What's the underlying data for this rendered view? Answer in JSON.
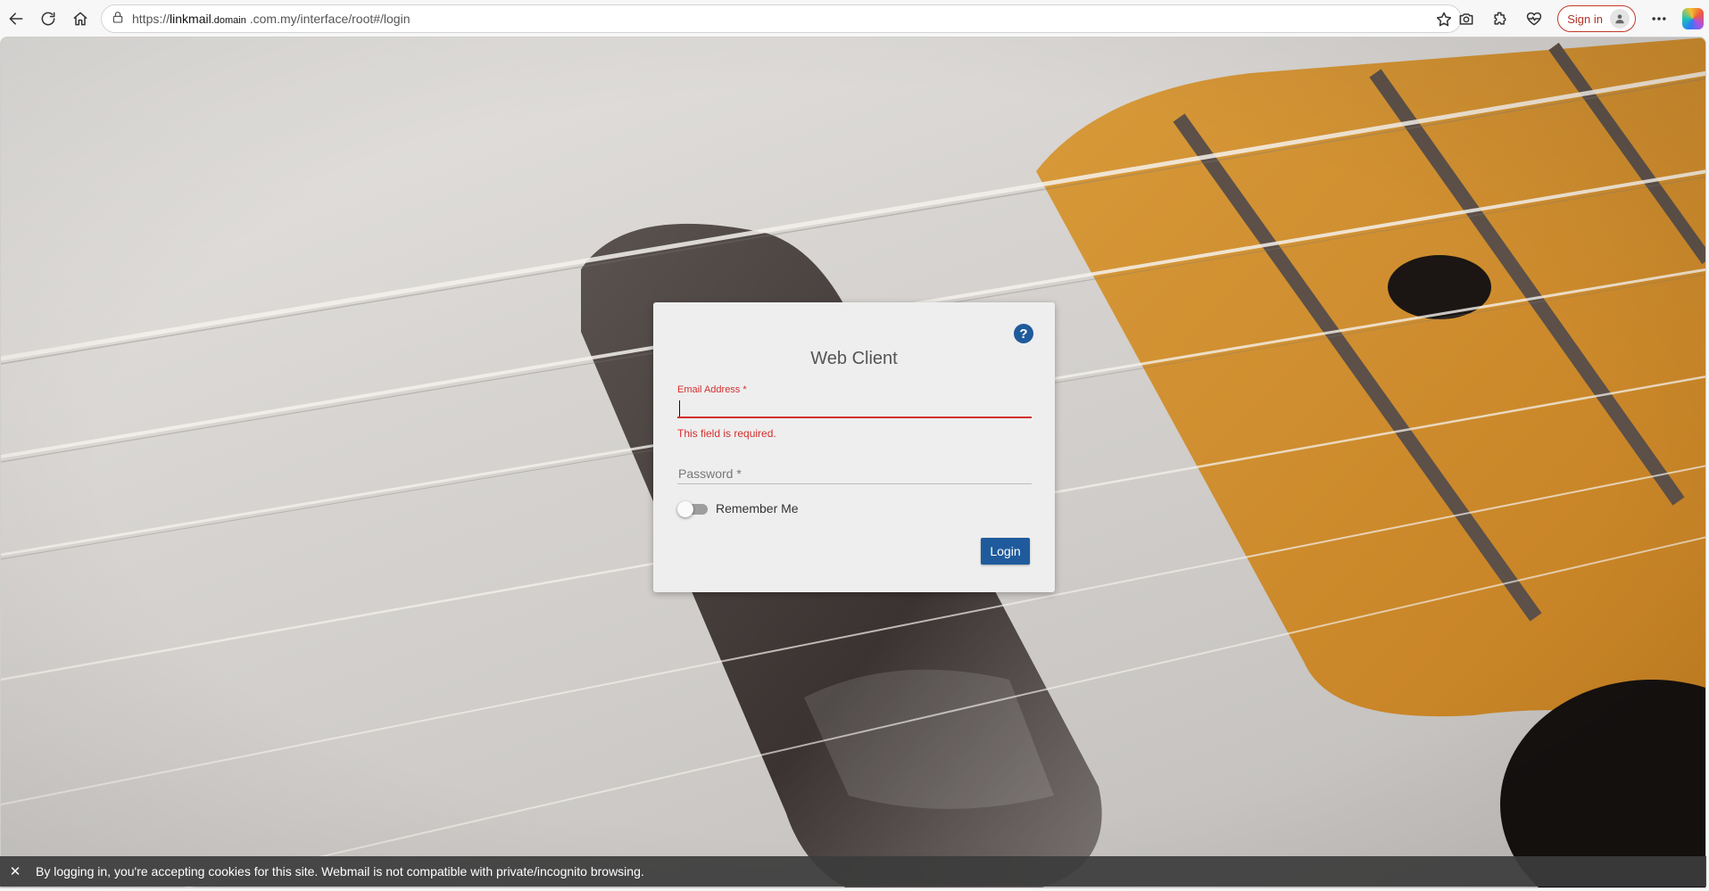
{
  "browser": {
    "url_scheme": "https://",
    "url_host": "linkmail",
    "url_small": ".domain",
    "url_rest": " .com.my/interface/root#/login",
    "signin_label": "Sign in"
  },
  "login": {
    "title": "Web Client",
    "help_icon": "?",
    "email_label": "Email Address *",
    "email_value": "",
    "email_error": "This field is required.",
    "password_placeholder": "Password *",
    "remember_label": "Remember Me",
    "remember_on": false,
    "login_label": "Login"
  },
  "cookie_banner": {
    "close_icon": "✕",
    "message": "By logging in, you're accepting cookies for this site. Webmail is not compatible with private/incognito browsing."
  },
  "colors": {
    "accent": "#1f5b9c",
    "error": "#d32f2f",
    "signin_border": "#c0392b"
  }
}
